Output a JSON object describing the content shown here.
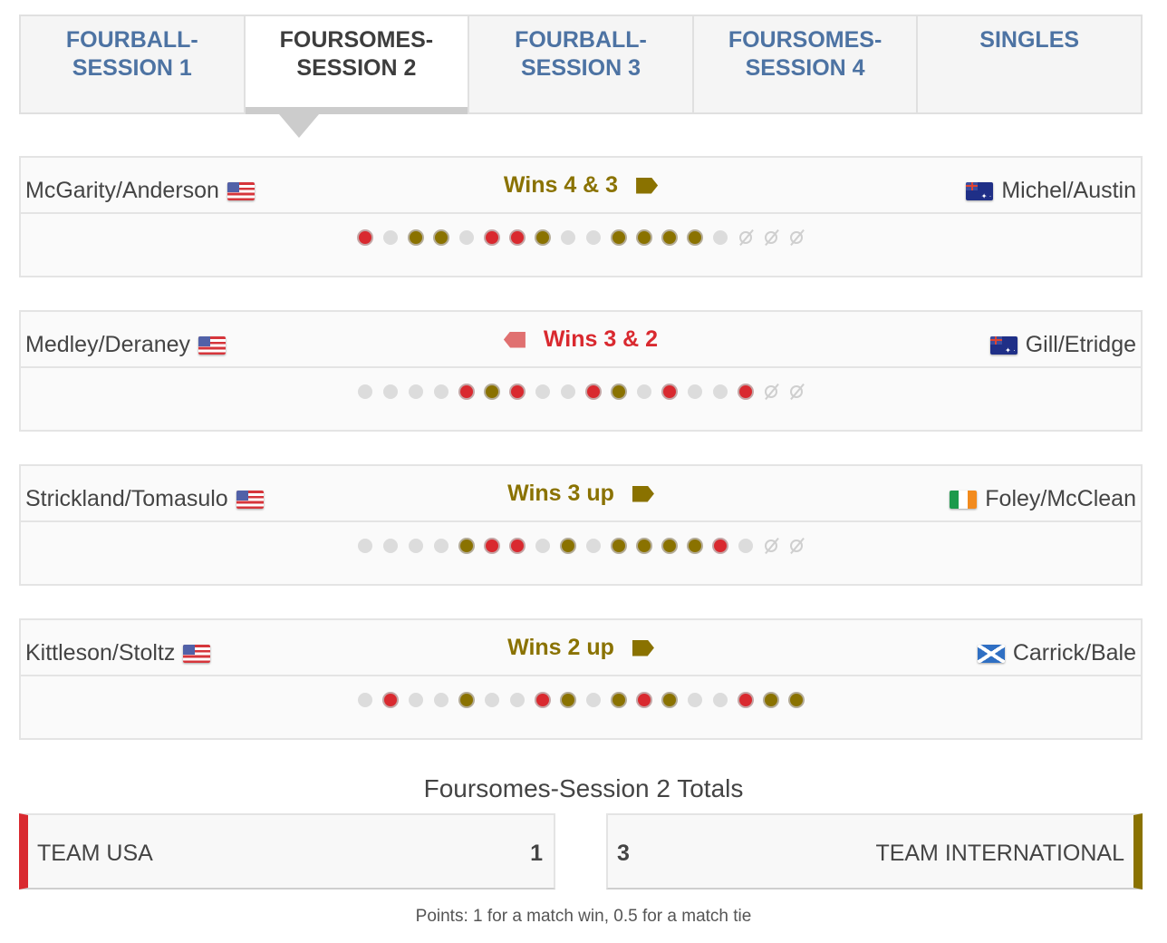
{
  "tabs": [
    {
      "line1": "FOURBALL-",
      "line2": "SESSION 1",
      "active": false
    },
    {
      "line1": "FOURSOMES-",
      "line2": "SESSION 2",
      "active": true
    },
    {
      "line1": "FOURBALL-",
      "line2": "SESSION 3",
      "active": false
    },
    {
      "line1": "FOURSOMES-",
      "line2": "SESSION 4",
      "active": false
    },
    {
      "line1": "SINGLES",
      "line2": "",
      "active": false
    }
  ],
  "colors": {
    "usa": "#d9292f",
    "international": "#8a7200",
    "tab_link": "#4d73a3"
  },
  "matches": [
    {
      "left_team": "McGarity/Anderson",
      "left_flag": "us-flag",
      "right_team": "Michel/Austin",
      "right_flag": "australia-flag",
      "result": "Wins 4 & 3",
      "winner": "international",
      "holes": [
        "r",
        "g",
        "o",
        "o",
        "g",
        "r",
        "r",
        "o",
        "g",
        "g",
        "o",
        "o",
        "o",
        "o",
        "g",
        "x",
        "x",
        "x"
      ]
    },
    {
      "left_team": "Medley/Deraney",
      "left_flag": "us-flag",
      "right_team": "Gill/Etridge",
      "right_flag": "new-zealand-flag",
      "result": "Wins 3 & 2",
      "winner": "usa",
      "holes": [
        "g",
        "g",
        "g",
        "g",
        "r",
        "o",
        "r",
        "g",
        "g",
        "r",
        "o",
        "g",
        "r",
        "g",
        "g",
        "r",
        "x",
        "x"
      ]
    },
    {
      "left_team": "Strickland/Tomasulo",
      "left_flag": "us-flag",
      "right_team": "Foley/McClean",
      "right_flag": "ireland-flag",
      "result": "Wins 3 up",
      "winner": "international",
      "holes": [
        "g",
        "g",
        "g",
        "g",
        "o",
        "r",
        "r",
        "g",
        "o",
        "g",
        "o",
        "o",
        "o",
        "o",
        "r",
        "g",
        "x",
        "x"
      ]
    },
    {
      "left_team": "Kittleson/Stoltz",
      "left_flag": "us-flag",
      "right_team": "Carrick/Bale",
      "right_flag": "scotland-flag",
      "result": "Wins 2 up",
      "winner": "international",
      "holes": [
        "g",
        "r",
        "g",
        "g",
        "o",
        "g",
        "g",
        "r",
        "o",
        "g",
        "o",
        "r",
        "o",
        "g",
        "g",
        "r",
        "o",
        "o"
      ]
    }
  ],
  "totals": {
    "title": "Foursomes-Session 2 Totals",
    "usa": {
      "name": "TEAM USA",
      "score": "1"
    },
    "international": {
      "name": "TEAM INTERNATIONAL",
      "score": "3"
    },
    "note": "Points: 1 for a match win, 0.5 for a match tie"
  }
}
